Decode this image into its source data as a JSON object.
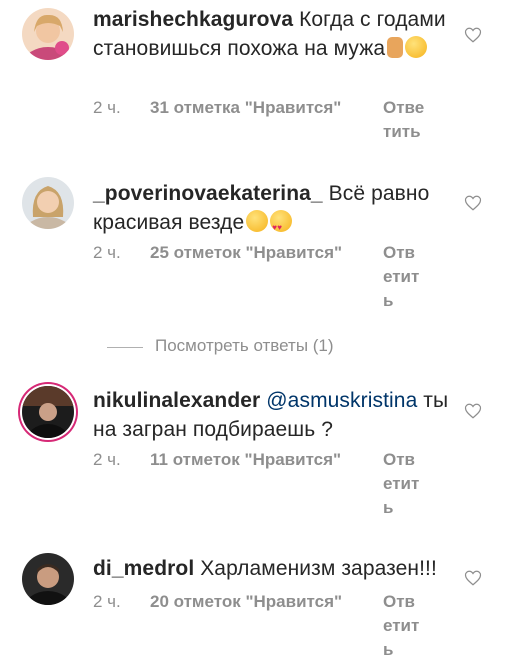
{
  "comments": [
    {
      "username": "marishechkagurova",
      "text": "Когда с годами становишься похожа на мужа",
      "time": "2 ч.",
      "likes": "31 отметка \"Нравится\"",
      "reply_lines": [
        "Отве",
        "тить"
      ],
      "emoji": [
        "thumbs-up",
        "grinning-face"
      ]
    },
    {
      "username": "_poverinovaekaterina_",
      "text": "Всё равно красивая везде",
      "time": "2 ч.",
      "likes": "25 отметок \"Нравится\"",
      "reply_lines": [
        "Отв",
        "етит",
        "ь"
      ],
      "emoji": [
        "grinning-face",
        "heart-eyes-face"
      ]
    },
    {
      "username": "nikulinalexander",
      "mention": "@asmuskristina",
      "text": "ты на загран подбираешь ?",
      "time": "2 ч.",
      "likes": "11 отметок \"Нравится\"",
      "reply_lines": [
        "Отв",
        "етит",
        "ь"
      ]
    },
    {
      "username": "di_medrol",
      "text": "Харламенизм заразен!!!",
      "time": "2 ч.",
      "likes": "20 отметок \"Нравится\"",
      "reply_lines": [
        "Отв",
        "етит",
        "ь"
      ]
    }
  ],
  "view_replies": "Посмотреть ответы (1)",
  "colors": {
    "accent_ring": "#d62976",
    "meta": "#8e8e8e",
    "mention": "#003569"
  }
}
